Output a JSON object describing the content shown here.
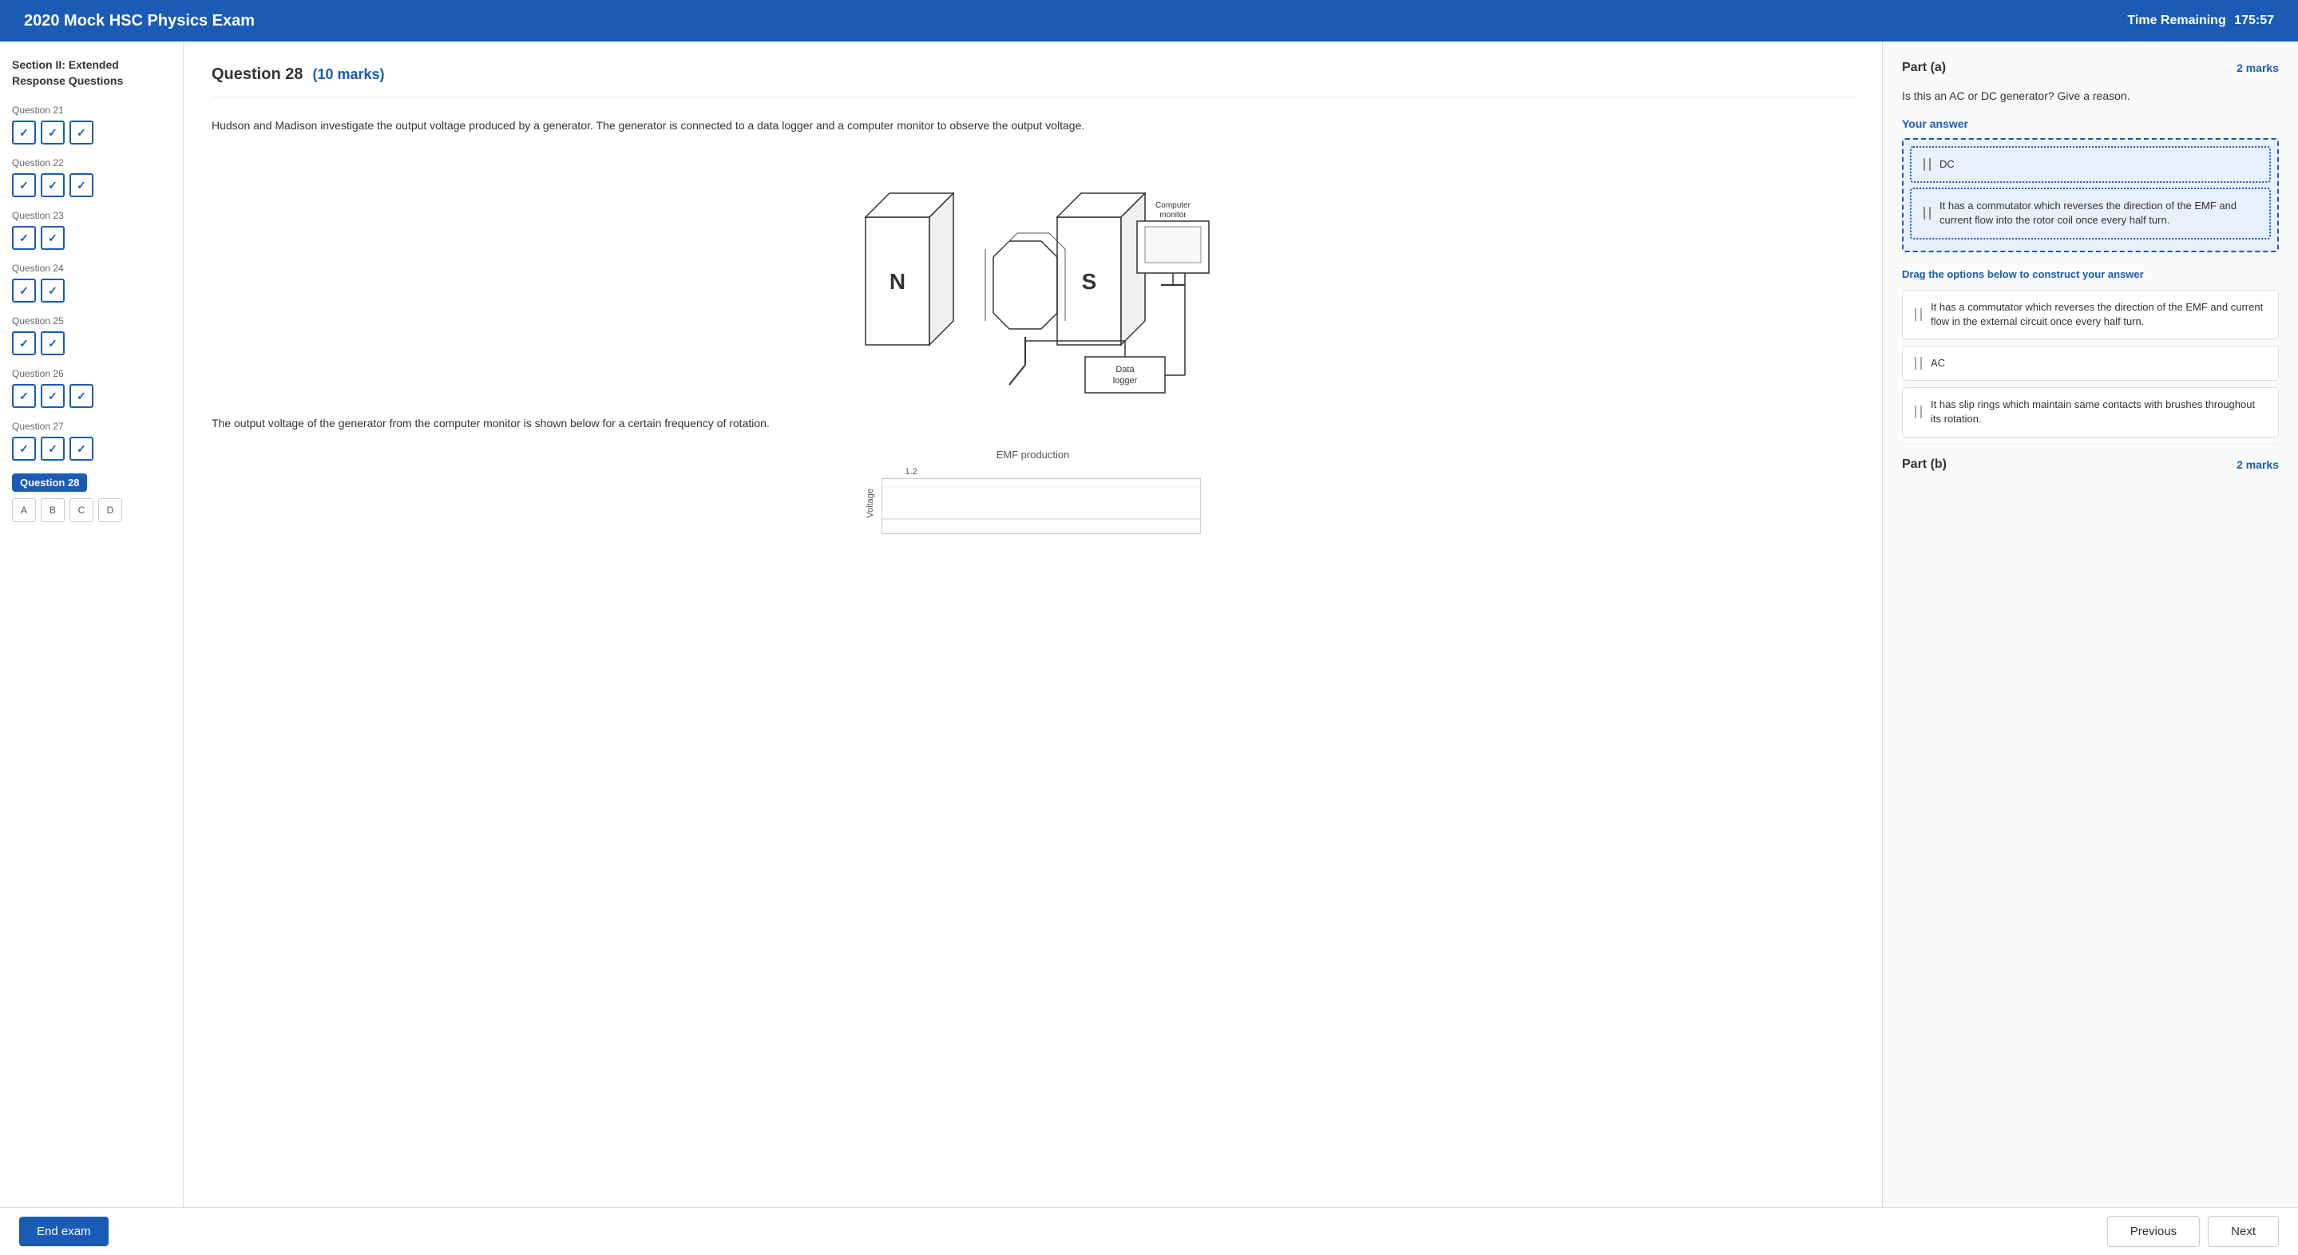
{
  "header": {
    "title": "2020 Mock HSC Physics Exam",
    "timer_label": "Time Remaining",
    "timer_value": "175:57"
  },
  "sidebar": {
    "title": "Section II: Extended Response Questions",
    "question_groups": [
      {
        "label": "Question 21",
        "checks": [
          "checked",
          "checked",
          "checked"
        ]
      },
      {
        "label": "Question 22",
        "checks": [
          "checked",
          "checked",
          "checked"
        ]
      },
      {
        "label": "Question 23",
        "checks": [
          "checked",
          "checked"
        ]
      },
      {
        "label": "Question 24",
        "checks": [
          "checked",
          "checked"
        ]
      },
      {
        "label": "Question 25",
        "checks": [
          "checked",
          "checked"
        ]
      },
      {
        "label": "Question 26",
        "checks": [
          "checked",
          "checked",
          "checked"
        ]
      },
      {
        "label": "Question 27",
        "checks": [
          "checked",
          "checked",
          "checked"
        ]
      }
    ],
    "current_question": "Question 28",
    "sub_questions": [
      "A",
      "B",
      "C",
      "D"
    ]
  },
  "question": {
    "number": "Question 28",
    "marks": "(10 marks)",
    "intro_text": "Hudson and Madison investigate the output voltage produced by a generator. The generator is connected to a data logger and a computer monitor to observe the output voltage.",
    "diagram_labels": {
      "N": "N",
      "S": "S",
      "computer_monitor": "Computer monitor",
      "data_logger": "Data logger"
    },
    "output_text": "The output voltage of the generator from the computer monitor is shown below for a certain frequency of rotation.",
    "graph_title": "EMF production",
    "graph_y_value": "1.2"
  },
  "answer_panel": {
    "part_a": {
      "label": "Part (a)",
      "marks": "2 marks",
      "question": "Is this an AC or DC generator? Give a reason.",
      "your_answer_label": "Your answer",
      "placed_answers": [
        "DC",
        "It has a commutator which reverses the direction of the EMF and current flow into the rotor coil once every half turn."
      ],
      "drag_instructions": "Drag the options below to construct your answer",
      "drag_options": [
        "It has a commutator which reverses the direction of the EMF and current flow in the external circuit once every half turn.",
        "AC",
        "It has slip rings which maintain same contacts with brushes throughout its rotation."
      ]
    },
    "part_b": {
      "label": "Part (b)",
      "marks": "2 marks"
    }
  },
  "footer": {
    "end_exam_label": "End exam",
    "previous_label": "Previous",
    "next_label": "Next"
  }
}
